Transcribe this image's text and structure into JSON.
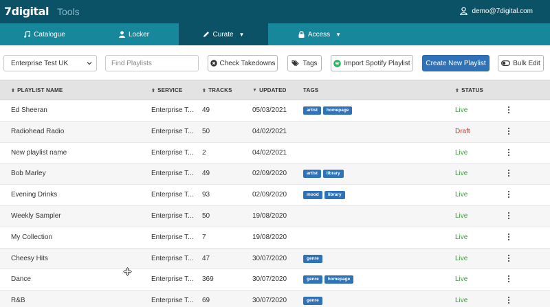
{
  "header": {
    "logo_mark": "7digital",
    "logo_tools": "Tools",
    "user": "demo@7digital.com"
  },
  "nav": [
    {
      "label": "Catalogue",
      "icon": "music-note-icon",
      "active": false,
      "dropdown": false
    },
    {
      "label": "Locker",
      "icon": "user-icon",
      "active": false,
      "dropdown": false
    },
    {
      "label": "Curate",
      "icon": "pencil-icon",
      "active": true,
      "dropdown": true
    },
    {
      "label": "Access",
      "icon": "lock-icon",
      "active": false,
      "dropdown": true
    }
  ],
  "toolbar": {
    "service_selected": "Enterprise Test UK",
    "search_placeholder": "Find Playlists",
    "check_takedowns": "Check Takedowns",
    "tags": "Tags",
    "import_spotify": "Import Spotify Playlist",
    "create_new": "Create New Playlist",
    "bulk_edit": "Bulk Edit"
  },
  "columns": {
    "name": "PLAYLIST NAME",
    "service": "SERVICE",
    "tracks": "TRACKS",
    "updated": "UPDATED",
    "tags": "TAGS",
    "status": "STATUS"
  },
  "rows": [
    {
      "name": "Ed Sheeran",
      "service": "Enterprise T...",
      "tracks": "49",
      "updated": "05/03/2021",
      "tags": [
        "artist",
        "homepage"
      ],
      "status": "Live"
    },
    {
      "name": "Radiohead Radio",
      "service": "Enterprise T...",
      "tracks": "50",
      "updated": "04/02/2021",
      "tags": [],
      "status": "Draft"
    },
    {
      "name": "New playlist name",
      "service": "Enterprise T...",
      "tracks": "2",
      "updated": "04/02/2021",
      "tags": [],
      "status": "Live"
    },
    {
      "name": "Bob Marley",
      "service": "Enterprise T...",
      "tracks": "49",
      "updated": "02/09/2020",
      "tags": [
        "artist",
        "library"
      ],
      "status": "Live"
    },
    {
      "name": "Evening Drinks",
      "service": "Enterprise T...",
      "tracks": "93",
      "updated": "02/09/2020",
      "tags": [
        "mood",
        "library"
      ],
      "status": "Live"
    },
    {
      "name": "Weekly Sampler",
      "service": "Enterprise T...",
      "tracks": "50",
      "updated": "19/08/2020",
      "tags": [],
      "status": "Live"
    },
    {
      "name": "My Collection",
      "service": "Enterprise T...",
      "tracks": "7",
      "updated": "19/08/2020",
      "tags": [],
      "status": "Live"
    },
    {
      "name": "Cheesy Hits",
      "service": "Enterprise T...",
      "tracks": "47",
      "updated": "30/07/2020",
      "tags": [
        "genre"
      ],
      "status": "Live"
    },
    {
      "name": "Dance",
      "service": "Enterprise T...",
      "tracks": "369",
      "updated": "30/07/2020",
      "tags": [
        "genre",
        "homepage"
      ],
      "status": "Live"
    },
    {
      "name": "R&B",
      "service": "Enterprise T...",
      "tracks": "69",
      "updated": "30/07/2020",
      "tags": [
        "genre"
      ],
      "status": "Live"
    }
  ],
  "colors": {
    "header_bg": "#0b5266",
    "nav_bg": "#17889c",
    "primary": "#2f72b8",
    "live": "#3c9a3c",
    "draft": "#c0392b"
  }
}
